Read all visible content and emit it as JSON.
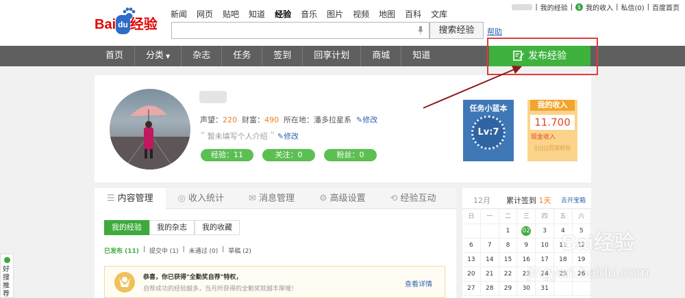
{
  "header": {
    "logo_bai": "Bai",
    "logo_du": "du",
    "logo_jingyan": "经验",
    "nav": [
      "新闻",
      "网页",
      "贴吧",
      "知道",
      "经验",
      "音乐",
      "图片",
      "视频",
      "地图",
      "百科",
      "文库"
    ],
    "nav_active_index": 4,
    "search_placeholder": "",
    "search_button": "搜索经验",
    "help": "帮助",
    "user_links": {
      "my_experience": "我的经验",
      "my_income": "我的收入",
      "messages": "私信(0)",
      "baidu_home": "百度首页"
    }
  },
  "navbar": {
    "items": [
      "首页",
      "分类",
      "杂志",
      "任务",
      "签到",
      "回享计划",
      "商城",
      "知道"
    ],
    "dropdown_index": 1,
    "publish_button": "发布经验"
  },
  "profile": {
    "stats": {
      "reputation_label": "声望：",
      "reputation": "220",
      "wealth_label": "财富：",
      "wealth": "490",
      "location_label": "所在地：",
      "location": "潘多拉星系",
      "edit": "修改"
    },
    "intro": "暂未填写个人介绍",
    "intro_edit": "修改",
    "pills": [
      "经验：11",
      "关注：0",
      "粉丝：0"
    ],
    "task_card": {
      "title": "任务小蓝本",
      "level": "Lv:7"
    },
    "income_card": {
      "title": "我的收入",
      "amount": "11.700",
      "label": "现金收入",
      "footer": "||||||||百度经验"
    }
  },
  "content": {
    "tabs": [
      "内容管理",
      "收入统计",
      "消息管理",
      "高级设置",
      "经验互动"
    ],
    "tab_icons": [
      "list-icon",
      "coin-icon",
      "mail-icon",
      "gear-icon",
      "refresh-icon"
    ],
    "active_tab": 0,
    "subtabs": [
      "我的经验",
      "我的杂志",
      "我的收藏"
    ],
    "active_subtab": 0,
    "filters": [
      "已发布 (11)",
      "提交中 (1)",
      "未通过 (0)",
      "草稿 (2)"
    ],
    "notice": {
      "title": "恭喜，你已获得\"全勤奖自荐\"特权，",
      "subtitle": "自荐成功的经验越多，当月所获得的全勤奖就越丰厚哦！",
      "link": "查看详情"
    }
  },
  "calendar": {
    "month": "12月",
    "sign_label": "累计签到",
    "sign_days": "1天",
    "treasure_link": "去开宝箱",
    "weekdays": [
      "日",
      "一",
      "二",
      "三",
      "四",
      "五",
      "六"
    ],
    "weeks": [
      [
        "",
        "",
        "1",
        "02",
        "3",
        "4",
        "5"
      ],
      [
        "6",
        "7",
        "8",
        "9",
        "10",
        "11",
        "12"
      ],
      [
        "13",
        "14",
        "15",
        "16",
        "17",
        "18",
        "19"
      ],
      [
        "20",
        "21",
        "22",
        "23",
        "24",
        "25",
        "26"
      ],
      [
        "27",
        "28",
        "29",
        "30",
        "31",
        "",
        ""
      ]
    ],
    "today": "02"
  },
  "watermark": {
    "text": "Bai经验",
    "url": "jingyan.baidu.com"
  },
  "side_widget": "好搜推荐",
  "colors": {
    "green": "#3eb23d",
    "red_box": "#e0393e",
    "navbar": "#5f5f5f",
    "orange": "#f07f22",
    "link": "#2d64b3"
  }
}
